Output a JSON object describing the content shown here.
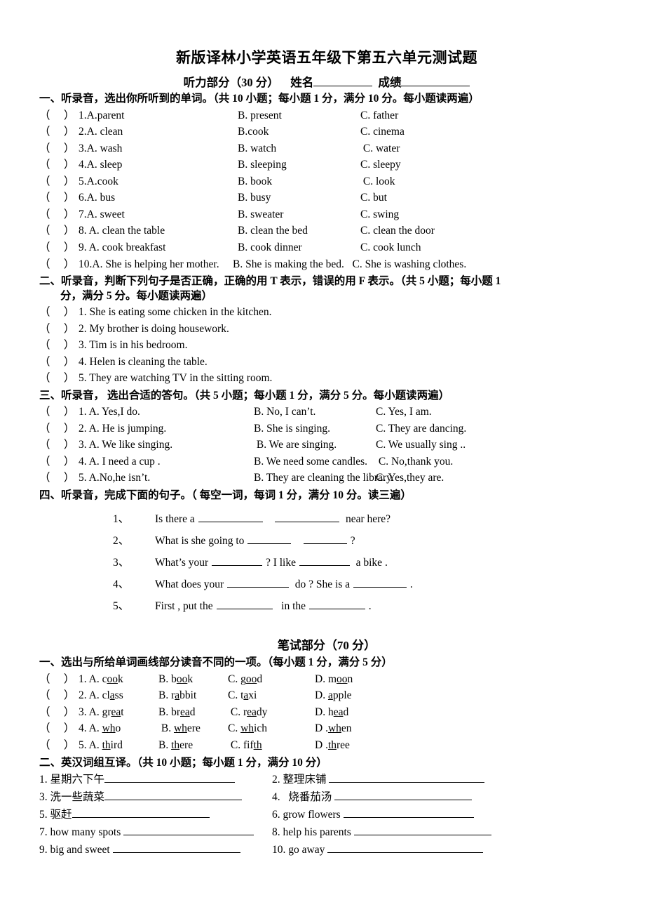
{
  "document": {
    "title": "新版译林小学英语五年级下第五六单元测试题",
    "listening_header": {
      "part_label": "听力部分（30 分）",
      "name_label": "姓名",
      "score_label": "成绩"
    },
    "written_header": "笔试部分（70 分）"
  },
  "listening": {
    "section1": {
      "instruction": "一、听录音，选出你所听到的单词。（共 10 小题；每小题 1 分，满分 10 分。每小题读两遍）",
      "paren": "（     ）",
      "items": [
        {
          "num": "1.",
          "a": "A.parent",
          "b": "B. present",
          "c": "C. father"
        },
        {
          "num": "2.",
          "a": "A. clean",
          "b": "B.cook",
          "c": "C. cinema"
        },
        {
          "num": "3.",
          "a": "A. wash",
          "b": "B. watch",
          "c": " C. water"
        },
        {
          "num": "4.",
          "a": "A. sleep",
          "b": "B. sleeping",
          "c": "C. sleepy"
        },
        {
          "num": "5.",
          "a": "A.cook",
          "b": "B. book",
          "c": " C. look"
        },
        {
          "num": "6.",
          "a": "A. bus",
          "b": "B. busy",
          "c": "C. but"
        },
        {
          "num": "7.",
          "a": "A. sweet",
          "b": "B. sweater",
          "c": "C. swing"
        },
        {
          "num": "8.",
          "a": " A. clean the table",
          "b": "B. clean the bed",
          "c": "C. clean the door"
        },
        {
          "num": "9.",
          "a": " A. cook breakfast",
          "b": "B. cook dinner",
          "c": "C. cook lunch"
        }
      ],
      "item10": {
        "num": "10.",
        "text": "A. She is helping her mother.     B. She is making the bed.   C. She is washing clothes."
      }
    },
    "section2": {
      "instruction_line1": "二、听录音，判断下列句子是否正确，正确的用 T 表示，错误的用 F 表示。（共 5 小题；每小题 1",
      "instruction_line2": "分，满分 5 分。每小题读两遍）",
      "paren": "（     ）",
      "items": [
        {
          "num": "1.",
          "text": " She is eating some chicken in the kitchen."
        },
        {
          "num": "2.",
          "text": " My brother is doing housework."
        },
        {
          "num": "3.",
          "text": " Tim is in his bedroom."
        },
        {
          "num": "4.",
          "text": " Helen is cleaning the table."
        },
        {
          "num": "5.",
          "text": " They are watching TV in the sitting room."
        }
      ]
    },
    "section3": {
      "instruction": "三、听录音，  选出合适的答句。（共 5 小题；每小题 1 分，满分 5 分。每小题读两遍）",
      "paren": "（     ）",
      "items": [
        {
          "num": "1.",
          "a": " A. Yes,I do.",
          "b": "B. No, I can’t.",
          "c": "C. Yes, I am."
        },
        {
          "num": "2.",
          "a": " A. He is jumping.",
          "b": "B. She is singing.",
          "c": "C. They are dancing."
        },
        {
          "num": "3.",
          "a": " A. We like singing.",
          "b": " B. We are singing.",
          "c": "C. We usually sing .."
        },
        {
          "num": "4.",
          "a": " A. I need a cup .",
          "b": "B. We need some candles.",
          "c": " C. No,thank you."
        },
        {
          "num": "5.",
          "a": " A.No,he isn’t.",
          "b": "B. They are cleaning the library.",
          "c": "C. Yes,they are."
        }
      ]
    },
    "section4": {
      "instruction": "四、听录音，完成下面的句子。（ 每空一词，每词 1 分，满分 10 分。读三遍）",
      "items": [
        {
          "num": "1、",
          "parts": [
            "Is there a ",
            "",
            "    ",
            "",
            "  near here?"
          ],
          "blanks": [
            92,
            92
          ]
        },
        {
          "num": "2、",
          "parts": [
            "What is she going to ",
            "",
            "    ",
            "",
            " ?"
          ],
          "blanks": [
            62,
            62
          ]
        },
        {
          "num": "3、",
          "parts": [
            "What’s your ",
            "",
            " ? I like ",
            "",
            "  a bike ."
          ],
          "blanks": [
            72,
            72
          ]
        },
        {
          "num": "4、",
          "parts": [
            "What does your ",
            "",
            "  do ? She is a ",
            "",
            " ."
          ],
          "blanks": [
            88,
            76
          ]
        },
        {
          "num": "5、",
          "parts": [
            "First , put the ",
            "",
            "   in the ",
            "",
            " ."
          ],
          "blanks": [
            80,
            80
          ]
        }
      ]
    }
  },
  "written": {
    "section1": {
      "instruction": "一、选出与所给单词画线部分读音不同的一项。（每小题 1 分，满分 5 分）",
      "paren": "（     ）",
      "items": [
        {
          "num": "1.",
          "a": {
            "pre": " A. c",
            "u": "oo",
            "post": "k"
          },
          "b": {
            "pre": "B. b",
            "u": "oo",
            "post": "k"
          },
          "c": {
            "pre": "C. g",
            "u": "oo",
            "post": "d"
          },
          "d": {
            "pre": "D. m",
            "u": "oo",
            "post": "n"
          }
        },
        {
          "num": "2.",
          "a": {
            "pre": " A. cl",
            "u": "a",
            "post": "ss"
          },
          "b": {
            "pre": "B. r",
            "u": "a",
            "post": "bbit"
          },
          "c": {
            "pre": "C. t",
            "u": "a",
            "post": "xi"
          },
          "d": {
            "pre": "D. ",
            "u": "a",
            "post": "pple"
          }
        },
        {
          "num": "3.",
          "a": {
            "pre": " A. gr",
            "u": "ea",
            "post": "t"
          },
          "b": {
            "pre": "B. br",
            "u": "ea",
            "post": "d"
          },
          "c": {
            "pre": " C. r",
            "u": "ea",
            "post": "dy"
          },
          "d": {
            "pre": "D. h",
            "u": "ea",
            "post": "d"
          }
        },
        {
          "num": "4.",
          "a": {
            "pre": " A. ",
            "u": "wh",
            "post": "o"
          },
          "b": {
            "pre": " B. ",
            "u": "wh",
            "post": "ere"
          },
          "c": {
            "pre": "C. ",
            "u": "wh",
            "post": "ich"
          },
          "d": {
            "pre": "D .",
            "u": "wh",
            "post": "en"
          }
        },
        {
          "num": "5.",
          "a": {
            "pre": " A. ",
            "u": "th",
            "post": "ird"
          },
          "b": {
            "pre": "B. ",
            "u": "th",
            "post": "ere"
          },
          "c": {
            "pre": " C. fif",
            "u": "th",
            "post": ""
          },
          "d": {
            "pre": "D .",
            "u": "th",
            "post": "ree"
          }
        }
      ]
    },
    "section2": {
      "instruction": "二、英汉词组互译。（共 10 小题；每小题 1 分，满分 10 分）",
      "pairs": [
        [
          {
            "num": "1. ",
            "text": "星期六下午",
            "blank": 186
          },
          {
            "num": "2. ",
            "text": "整理床铺 ",
            "blank": 222
          }
        ],
        [
          {
            "num": "3. ",
            "text": "洗一些蔬菜",
            "blank": 196
          },
          {
            "num": "4. ",
            "text": "  烧番茄汤 ",
            "blank": 196
          }
        ],
        [
          {
            "num": "5. ",
            "text": "驱赶",
            "blank": 196
          },
          {
            "num": "6. ",
            "text": "grow flowers ",
            "blank": 186
          }
        ],
        [
          {
            "num": "7. ",
            "text": "how many spots ",
            "blank": 186
          },
          {
            "num": "8. ",
            "text": "help his parents ",
            "blank": 196
          }
        ],
        [
          {
            "num": "9. ",
            "text": "big and sweet ",
            "blank": 182
          },
          {
            "num": "10. ",
            "text": "go away ",
            "blank": 222
          }
        ]
      ]
    }
  }
}
